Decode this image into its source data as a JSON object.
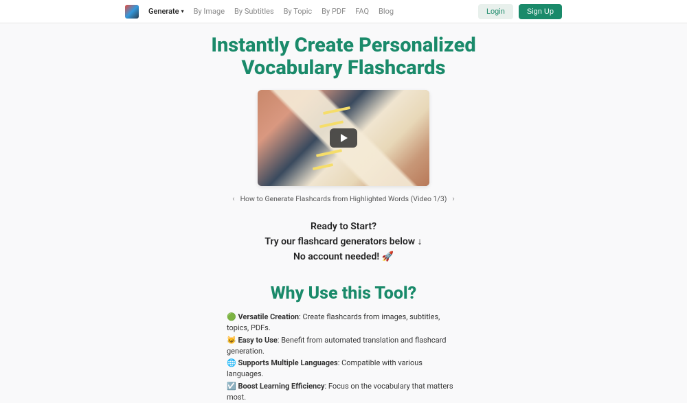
{
  "nav": {
    "generate": "Generate",
    "byImage": "By Image",
    "bySubtitles": "By Subtitles",
    "byTopic": "By Topic",
    "byPDF": "By PDF",
    "faq": "FAQ",
    "blog": "Blog",
    "login": "Login",
    "signup": "Sign Up"
  },
  "hero": {
    "title": "Instantly Create Personalized Vocabulary Flashcards"
  },
  "carousel": {
    "prev": "‹",
    "caption": "How to Generate Flashcards from Highlighted Words (Video 1/3)",
    "next": "›"
  },
  "cta": {
    "line1": "Ready to Start?",
    "line2": "Try our flashcard generators below ↓",
    "line3": "No account needed! 🚀"
  },
  "why": {
    "title": "Why Use this Tool?",
    "features": [
      {
        "icon": "🟢",
        "bold": "Versatile Creation",
        "text": ": Create flashcards from images, subtitles, topics, PDFs."
      },
      {
        "icon": "😺",
        "bold": "Easy to Use",
        "text": ": Benefit from automated translation and flashcard generation."
      },
      {
        "icon": "🌐",
        "bold": "Supports Multiple Languages",
        "text": ": Compatible with various languages."
      },
      {
        "icon": "☑️",
        "bold": "Boost Learning Efficiency",
        "text": ": Focus on the vocabulary that matters most."
      }
    ]
  }
}
